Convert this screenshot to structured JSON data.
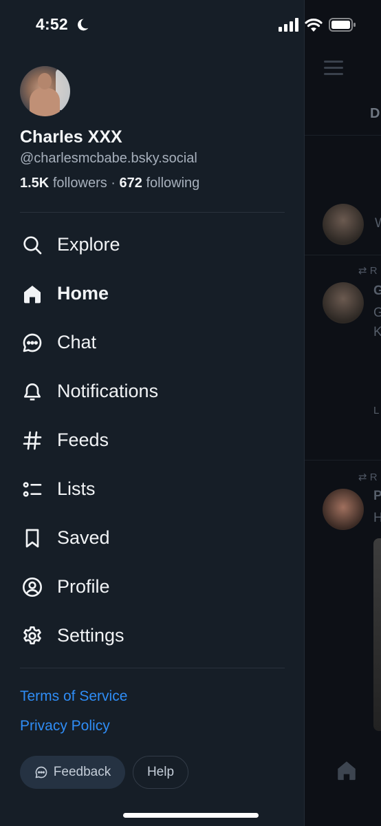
{
  "status_bar": {
    "time": "4:52"
  },
  "profile": {
    "display_name": "Charles XXX",
    "handle": "@charlesmcbabe.bsky.social",
    "followers_count": "1.5K",
    "followers_label": "followers",
    "separator": "·",
    "following_count": "672",
    "following_label": "following"
  },
  "nav": {
    "items": [
      {
        "label": "Explore",
        "icon": "search-icon"
      },
      {
        "label": "Home",
        "icon": "home-icon",
        "active": true
      },
      {
        "label": "Chat",
        "icon": "chat-icon"
      },
      {
        "label": "Notifications",
        "icon": "bell-icon"
      },
      {
        "label": "Feeds",
        "icon": "hashtag-icon"
      },
      {
        "label": "Lists",
        "icon": "list-icon"
      },
      {
        "label": "Saved",
        "icon": "bookmark-icon"
      },
      {
        "label": "Profile",
        "icon": "user-circle-icon"
      },
      {
        "label": "Settings",
        "icon": "gear-icon"
      }
    ]
  },
  "footer": {
    "terms": "Terms of Service",
    "privacy": "Privacy Policy",
    "feedback": "Feedback",
    "help": "Help"
  },
  "background_feed": {
    "tab_fragment": "D",
    "composer_fragment": "W",
    "repost_fragment_1": "R",
    "author_fragment_1": "G",
    "text_fragment_1a": "G",
    "text_fragment_1b": "K",
    "meta_fragment_1": "L",
    "repost_fragment_2": "R",
    "author_fragment_2": "P",
    "text_fragment_2": "H"
  },
  "colors": {
    "drawer_bg": "#161e27",
    "link": "#2f8df6",
    "text_primary": "#f1f3f5",
    "text_secondary": "#a7b0bc"
  }
}
